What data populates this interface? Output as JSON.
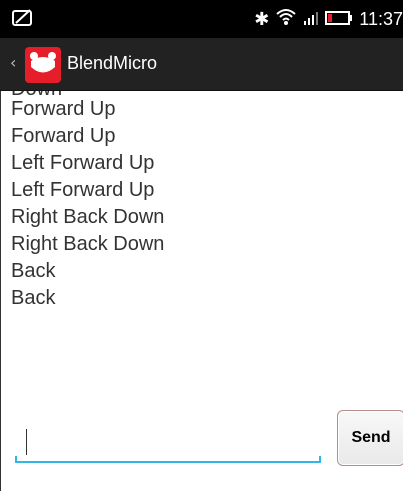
{
  "status_bar": {
    "time": "11:37",
    "icons": [
      "signature-icon",
      "bluetooth-icon",
      "wifi-icon",
      "signal-icon",
      "battery-icon"
    ]
  },
  "action_bar": {
    "title": "BlendMicro",
    "accent": "#e61e2a"
  },
  "log": {
    "partial_top_line": "Down",
    "lines": [
      "Forward Up",
      "Forward Up",
      "Left Forward Up",
      "Left Forward Up",
      "Right Back Down",
      "Right Back Down",
      "Back",
      "Back"
    ]
  },
  "composer": {
    "input_value": "",
    "send_label": "Send",
    "accent": "#33b5e5"
  }
}
